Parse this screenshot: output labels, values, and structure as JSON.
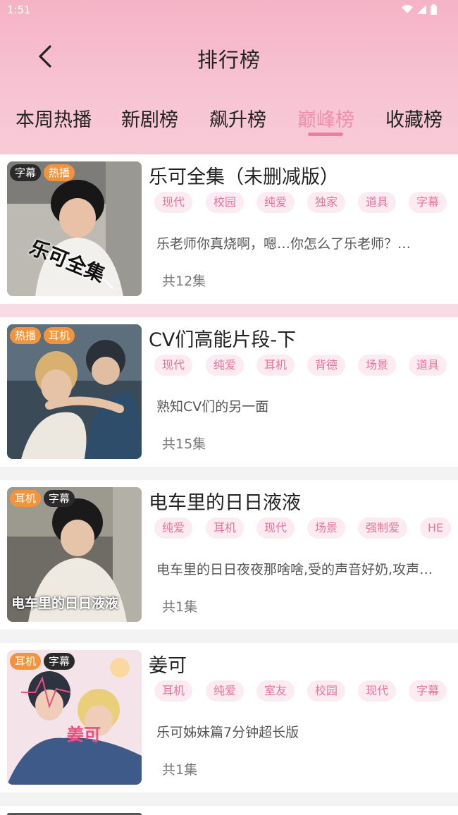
{
  "status": {
    "time": "1:51"
  },
  "header": {
    "title": "排行榜"
  },
  "tabs": [
    {
      "label": "本周热播"
    },
    {
      "label": "新剧榜"
    },
    {
      "label": "飙升榜"
    },
    {
      "label": "巅峰榜"
    },
    {
      "label": "收藏榜"
    }
  ],
  "colors": {
    "accent": "#ee7ea1",
    "tag_bg": "#fcebf0",
    "tag_text": "#e8739a",
    "badge_orange": "#f2943c",
    "badge_dark": "#2a2a2a"
  },
  "cards": [
    {
      "title": "乐可全集（未删减版）",
      "badges": [
        "字幕",
        "热播"
      ],
      "tags": [
        "现代",
        "校园",
        "纯爱",
        "独家",
        "道具",
        "字幕"
      ],
      "desc": "乐老师你真烧啊，嗯…你怎么了乐老师？…",
      "episodes": "共12集",
      "cover_text": "乐可全集"
    },
    {
      "title": "CV们高能片段-下",
      "badges": [
        "热播",
        "耳机"
      ],
      "tags": [
        "现代",
        "纯爱",
        "耳机",
        "背德",
        "场景",
        "道具"
      ],
      "desc": "熟知CV们的另一面",
      "episodes": "共15集",
      "cover_text": ""
    },
    {
      "title": "电车里的日日液液",
      "badges": [
        "耳机",
        "字幕"
      ],
      "tags": [
        "纯爱",
        "耳机",
        "现代",
        "场景",
        "强制爱",
        "HE"
      ],
      "desc": "电车里的日日夜夜那啥啥,受的声音好奶,攻声…",
      "episodes": "共1集",
      "cover_text": "电车里的日日液液"
    },
    {
      "title": "姜可",
      "badges": [
        "耳机",
        "字幕"
      ],
      "tags": [
        "耳机",
        "纯爱",
        "室友",
        "校园",
        "现代",
        "字幕"
      ],
      "desc": "乐可姊妹篇7分钟超长版",
      "episodes": "共1集",
      "cover_text": "姜可"
    }
  ]
}
